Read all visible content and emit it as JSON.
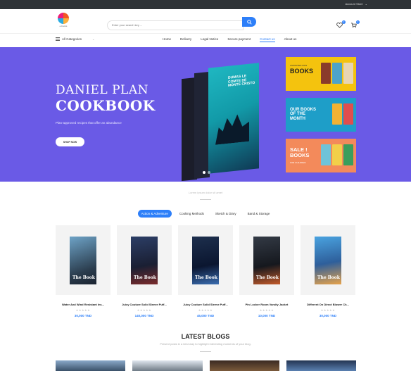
{
  "topbar": {
    "account_label": "Account Store",
    "currency": "TND"
  },
  "header": {
    "logo_text": "e-books",
    "search_placeholder": "Enter your search key ...",
    "wishlist_count": "0",
    "cart_count": "0"
  },
  "nav": {
    "categories_label": "All Categories",
    "menu": [
      "Home",
      "Delivery",
      "Legal Notice",
      "Secure payment",
      "Contact us",
      "About us"
    ],
    "active_index": 4
  },
  "hero": {
    "title_line1": "DANIEL PLAN",
    "title_line2": "COOKBOOK",
    "subtitle": "Plan-approved recipes that offer an abundance",
    "cta": "SHOP NOW",
    "book_title": "DUMAS LE COMTE DE MONTE CRISTO",
    "promos": [
      {
        "title": "BOOKS",
        "tiny": "ASSORTED KIDS"
      },
      {
        "title": "OUR BOOKS OF THE MONTH",
        "tiny": ""
      },
      {
        "title": "SALE ! BOOKS",
        "tiny": "FOR CHILDREN"
      }
    ]
  },
  "products_section": {
    "subtitle": "Lorem ipsum dolor sit amet",
    "tabs": [
      "Action & Adventure",
      "Cooking Methods",
      "Sketch & Diary",
      "Band & Storage"
    ],
    "active_tab": 0,
    "items": [
      {
        "cover_text": "The Book",
        "name": "Water And Wind Resistant Ins...",
        "price": "30,000 TND"
      },
      {
        "cover_text": "The Book",
        "name": "Juicy Couture Solid Sleeve Puff...",
        "price": "140,000 TND"
      },
      {
        "cover_text": "The Book",
        "name": "Juicy Couture Solid Sleeve Puff...",
        "price": "45,000 TND"
      },
      {
        "cover_text": "The Book",
        "name": "Pin Locker Room Varsity Jacket",
        "price": "10,000 TND"
      },
      {
        "cover_text": "The Book",
        "name": "Different On Direct Blower Ch...",
        "price": "30,000 TND"
      }
    ],
    "stars": "★★★★★"
  },
  "blogs": {
    "title": "LATEST BLOGS",
    "subtitle": "Present posts in a best way to highlight interesting moments of your blog."
  },
  "colors": {
    "accent": "#2d7ff9",
    "hero_bg": "#6a5ae6"
  }
}
